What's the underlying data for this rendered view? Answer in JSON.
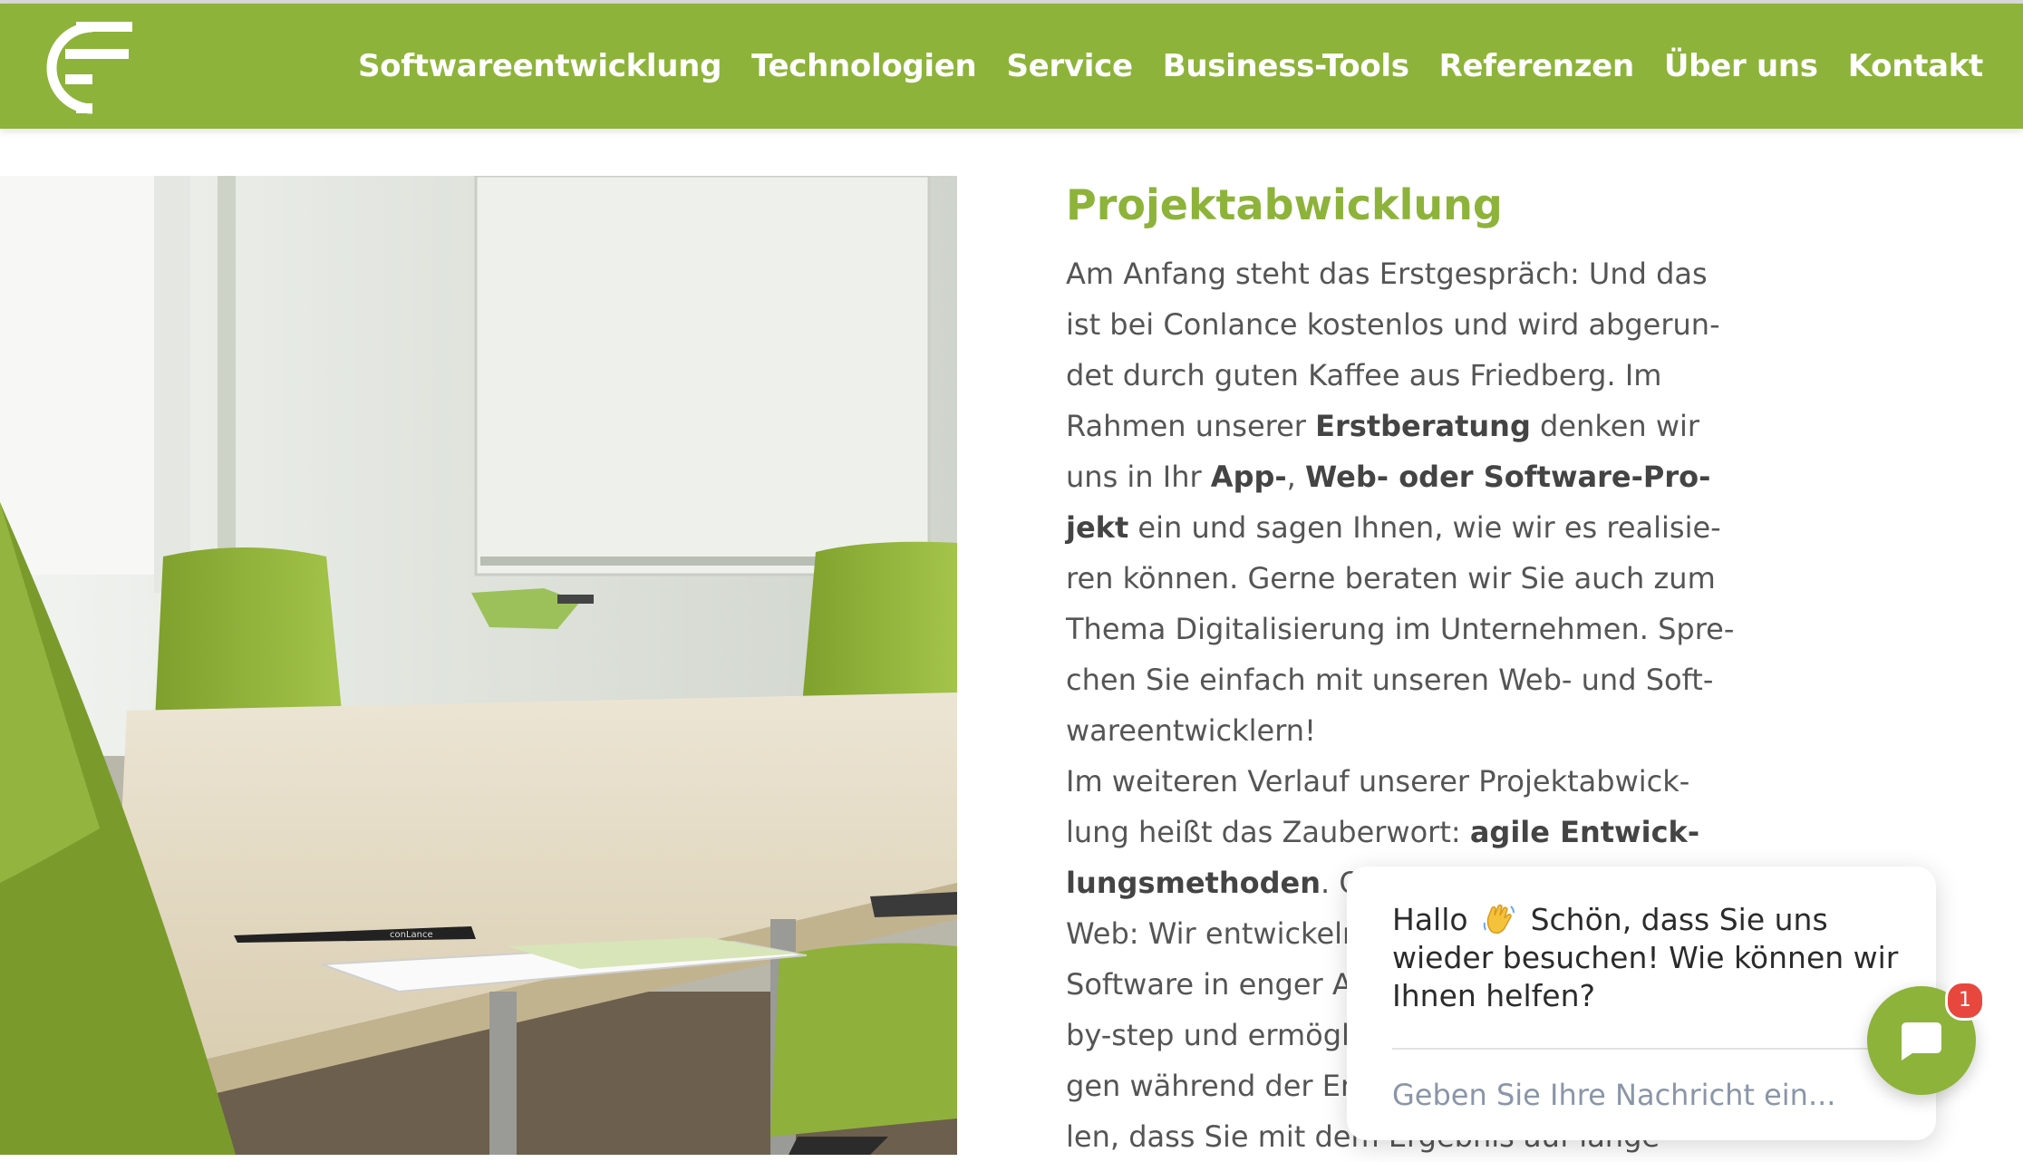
{
  "header": {
    "logo_icon": "conlance-logo-icon",
    "nav": [
      "Softwareentwicklung",
      "Technologien",
      "Service",
      "Business-Tools",
      "Referenzen",
      "Über uns",
      "Kontakt"
    ]
  },
  "photo": {
    "pen_logo_text": "conLance"
  },
  "main": {
    "title": "Projektabwicklung",
    "lines": [
      [
        "Am Anfang steht das Erstgespräch: Und das"
      ],
      [
        "ist bei Conlance kostenlos und wird abgerun-"
      ],
      [
        "det durch guten Kaffee aus Friedberg. Im"
      ],
      [
        "Rahmen unserer ",
        "Erstberatung",
        " denken wir"
      ],
      [
        "uns in Ihr ",
        "App-",
        ", ",
        "Web- oder Software-Pro-"
      ],
      [
        "jekt",
        " ein und sagen Ihnen, wie wir es realisie-"
      ],
      [
        "ren können. Gerne beraten wir Sie auch zum"
      ],
      [
        "Thema Digitalisierung im Unternehmen. Spre-"
      ],
      [
        "chen Sie einfach mit unseren Web- und Soft-"
      ],
      [
        "wareentwicklern!"
      ],
      [
        "Im weiteren Verlauf unserer Projektabwick-"
      ],
      [
        "lung heißt das Zauberwort: ",
        "agile Entwick-"
      ],
      [
        "lungsmethoden",
        ". Ob"
      ],
      [
        "Web: Wir entwickeln"
      ],
      [
        "Software in enger Ab"
      ],
      [
        "by-step und ermöglic"
      ],
      [
        "gen während der Ent"
      ],
      [
        "len, dass Sie mit dem Ergebnis auf lange"
      ]
    ]
  },
  "chat": {
    "greeting_before": "Hallo",
    "greeting_emoji_icon": "waving-hand-icon",
    "greeting_after": "Schön, dass Sie uns wieder besuchen! Wie können wir Ihnen helfen?",
    "input_placeholder": "Geben Sie Ihre Nachricht ein...",
    "button_icon": "chat-bubble-icon",
    "badge_count": "1"
  },
  "colors": {
    "brand_green": "#8db33a",
    "text_gray": "#555555",
    "badge_red": "#e8473d"
  }
}
